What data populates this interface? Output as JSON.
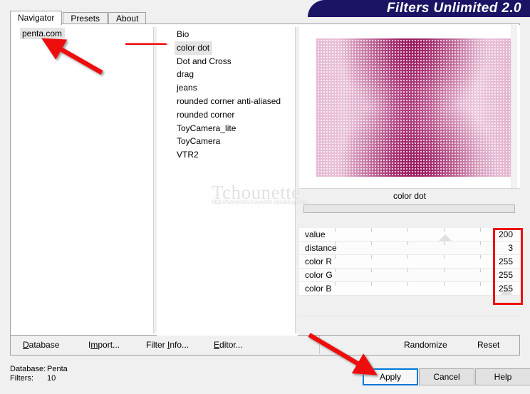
{
  "app": {
    "title": "Filters Unlimited 2.0",
    "banner_color": "#1b1464"
  },
  "tabs": [
    {
      "label": "Navigator",
      "active": true
    },
    {
      "label": "Presets",
      "active": false
    },
    {
      "label": "About",
      "active": false
    }
  ],
  "navigator": {
    "items": [
      {
        "label": "penta.com",
        "selected": true
      }
    ]
  },
  "filters": {
    "items": [
      {
        "label": "Bio",
        "selected": false
      },
      {
        "label": "color dot",
        "selected": true
      },
      {
        "label": "Dot and Cross",
        "selected": false
      },
      {
        "label": "drag",
        "selected": false
      },
      {
        "label": "jeans",
        "selected": false
      },
      {
        "label": "rounded corner anti-aliased",
        "selected": false
      },
      {
        "label": "rounded corner",
        "selected": false
      },
      {
        "label": "ToyCamera_lite",
        "selected": false
      },
      {
        "label": "ToyCamera",
        "selected": false
      },
      {
        "label": "VTR2",
        "selected": false
      }
    ]
  },
  "parameters": {
    "title": "color dot",
    "rows": [
      {
        "label": "value",
        "value": "200",
        "thumb_pct": 70
      },
      {
        "label": "distance",
        "value": "3",
        "thumb_pct": 0
      },
      {
        "label": "color R",
        "value": "255",
        "thumb_pct": 100
      },
      {
        "label": "color G",
        "value": "255",
        "thumb_pct": 100
      },
      {
        "label": "color B",
        "value": "255",
        "thumb_pct": 100
      }
    ]
  },
  "command_bar": {
    "database": {
      "pre": "",
      "accel": "D",
      "post": "atabase"
    },
    "import": {
      "pre": "I",
      "accel": "m",
      "post": "port..."
    },
    "filter_info": {
      "pre": "Filter ",
      "accel": "I",
      "post": "nfo..."
    },
    "editor": {
      "pre": "",
      "accel": "E",
      "post": "ditor..."
    },
    "randomize": "Randomize",
    "reset": "Reset"
  },
  "status": {
    "database_key": "Database:",
    "database_value": "Penta",
    "filters_key": "Filters:",
    "filters_value": "10"
  },
  "dialog_buttons": {
    "apply": "Apply",
    "cancel": "Cancel",
    "help": "Help"
  },
  "watermark": {
    "title": "Tchounette",
    "url": "http://tutorielstchounette.eklablog.com"
  },
  "annotations": {
    "arrow_color": "#ee1111",
    "arrow_1_target": "penta.com",
    "arrow_2_target": "color dot",
    "arrow_3_target": "Apply",
    "highlight_box_target": "parameter-values"
  }
}
